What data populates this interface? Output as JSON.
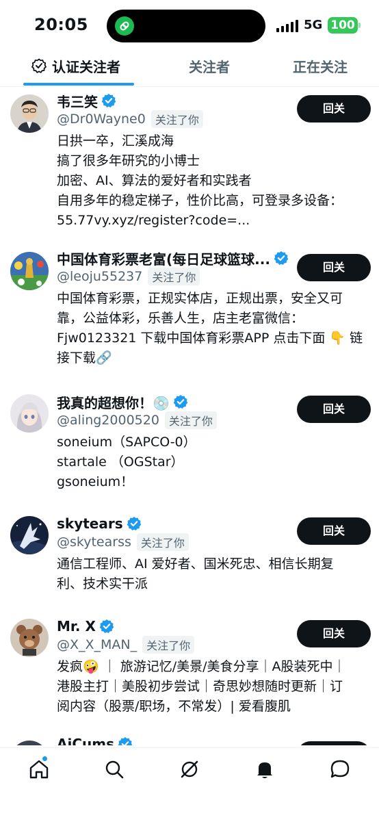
{
  "status_bar": {
    "time": "20:05",
    "network": "5G",
    "battery": "100"
  },
  "tabs": [
    {
      "label": "认证关注者",
      "active": true
    },
    {
      "label": "关注者",
      "active": false
    },
    {
      "label": "正在关注",
      "active": false
    }
  ],
  "users": [
    {
      "name": "韦三笑",
      "handle": "@Dr0Wayne0",
      "follows_you": "关注了你",
      "button": "回关",
      "bio": [
        "日拱一卒，汇溪成海",
        "搞了很多年研究的小博士",
        "加密、AI、算法的爱好者和实践者",
        "自用多年的稳定梯子，性价比高，可登录多设备：",
        "55.77vy.xyz/register?code=..."
      ]
    },
    {
      "name": "中国体育彩票老富(每日足球篮球...",
      "handle": "@leoju55237",
      "follows_you": "关注了你",
      "button": "回关",
      "bio": [
        "中国体育彩票，正规实体店，正规出票，安全又可",
        "靠，公益体彩，乐善人生，店主老富微信：",
        "Fjw0123321 下载中国体育彩票APP 点击下面 👇 链",
        "接下载🔗"
      ]
    },
    {
      "name": "我真的超想你！💿",
      "handle": "@aling2000520",
      "follows_you": "关注了你",
      "button": "回关",
      "bio": [
        "soneium（SAPCO-0）",
        "startale （OGStar）",
        "gsoneium！"
      ]
    },
    {
      "name": "skytears",
      "handle": "@skytearss",
      "follows_you": "关注了你",
      "button": "回关",
      "bio": [
        "通信工程师、AI 爱好者、国米死忠、相信长期复",
        "利、技术实干派"
      ]
    },
    {
      "name": "Mr. X",
      "handle": "@X_X_MAN_",
      "follows_you": "关注了你",
      "button": "回关",
      "bio": [
        "发疯🤪 ｜ 旅游记忆/美景/美食分享｜A股装死中｜",
        "港股主打｜美股初步尝试｜奇思妙想随时更新｜订",
        "阅内容（股票/职场，不常发）| 爱看腹肌"
      ]
    },
    {
      "name": "AiCums",
      "handle": "",
      "follows_you": "",
      "button": "",
      "bio": []
    }
  ],
  "bottom_nav": [
    "home-icon",
    "search-icon",
    "grok-icon",
    "notifications-icon",
    "messages-icon"
  ],
  "colors": {
    "accent": "#1d9bf0",
    "text": "#0f1419",
    "muted": "#536471",
    "button": "#0f1419",
    "battery": "#34c759"
  }
}
